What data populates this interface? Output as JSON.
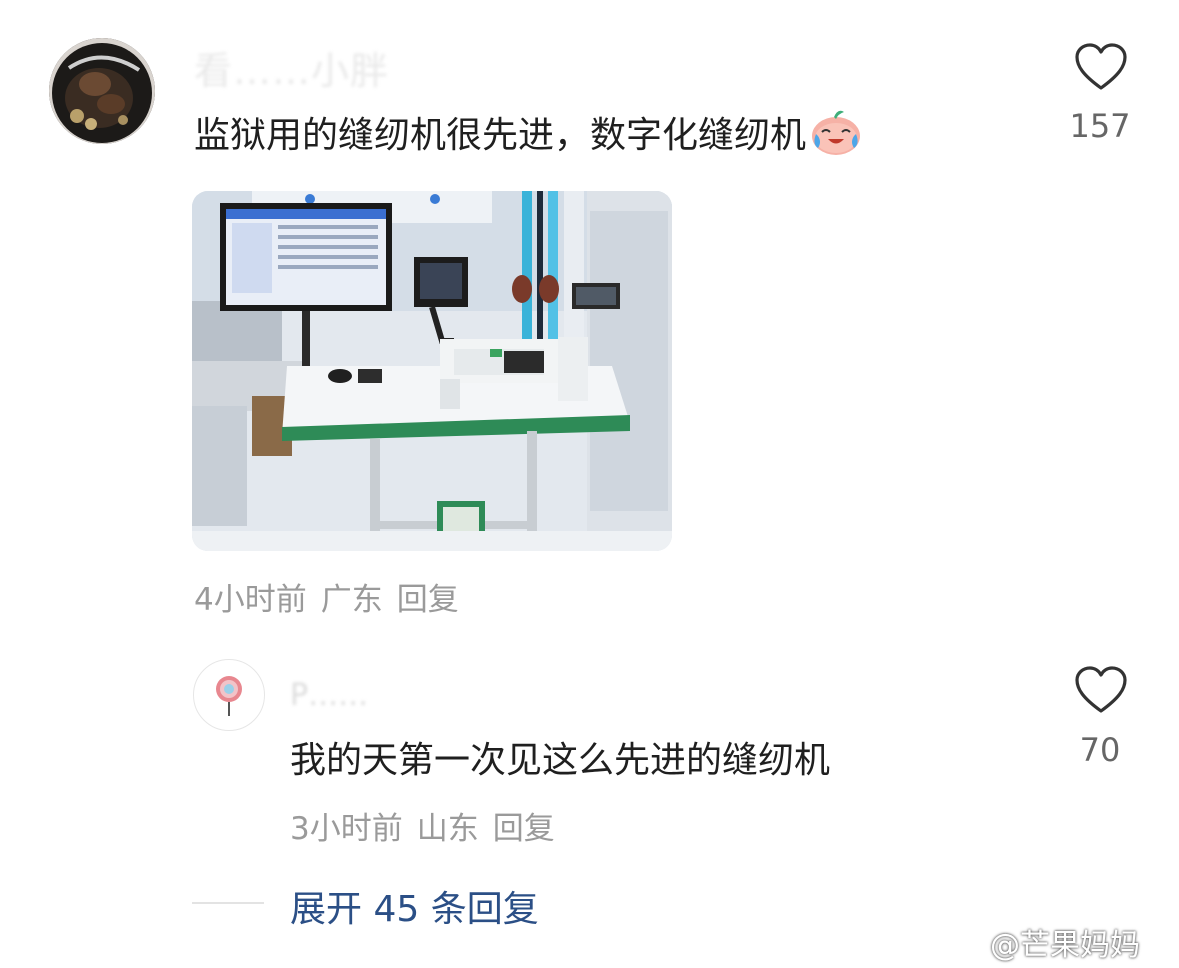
{
  "comments": [
    {
      "username": "看……小胖",
      "text": "监狱用的缝纫机很先进，数字化缝纫机",
      "emoji": "crying-laughing-emoji",
      "image": "sewing-machine-photo",
      "time": "4小时前",
      "location": "广东",
      "reply_label": "回复",
      "likes": "157"
    },
    {
      "username": "P……",
      "text": "我的天第一次见这么先进的缝纫机",
      "time": "3小时前",
      "location": "山东",
      "reply_label": "回复",
      "likes": "70"
    }
  ],
  "expand_replies": "展开 45 条回复",
  "watermark": "@芒果妈妈",
  "colors": {
    "link": "#2b4f86",
    "meta": "#9a9a9a",
    "text": "#1f1f1f"
  }
}
